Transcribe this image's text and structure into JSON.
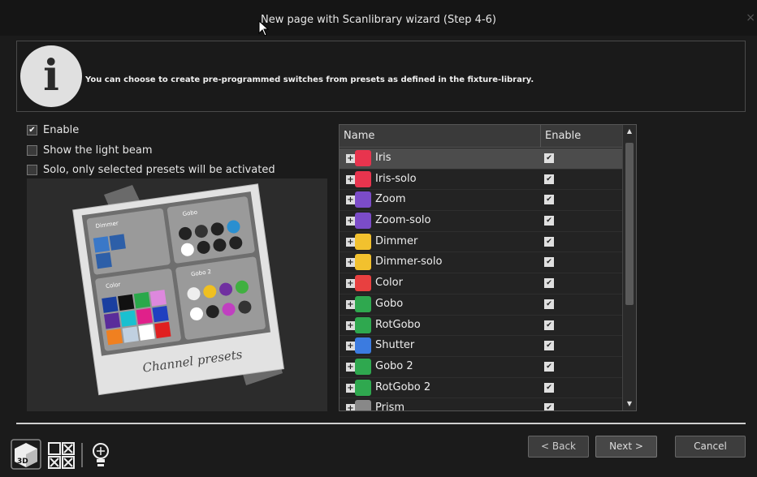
{
  "window": {
    "title": "New page with Scanlibrary wizard (Step 4-6)",
    "close": "×"
  },
  "info": {
    "icon": "i",
    "text": "You can choose to create pre-programmed switches from presets as defined in the fixture-library."
  },
  "options": [
    {
      "label": "Enable",
      "checked": true
    },
    {
      "label": "Show the light beam",
      "checked": false
    },
    {
      "label": "Solo, only selected presets will be activated",
      "checked": false
    }
  ],
  "preview": {
    "caption": "Channel presets",
    "panels": [
      "Dimmer",
      "Gobo",
      "Color",
      "Gobo 2"
    ]
  },
  "table": {
    "headers": {
      "name": "Name",
      "enable": "Enable"
    },
    "rows": [
      {
        "name": "Iris",
        "icon": "iris-icon",
        "color": "#e8344e",
        "checked": true
      },
      {
        "name": "Iris-solo",
        "icon": "iris-icon",
        "color": "#e8344e",
        "checked": true
      },
      {
        "name": "Zoom",
        "icon": "zoom-icon",
        "color": "#7b4cc8",
        "checked": true
      },
      {
        "name": "Zoom-solo",
        "icon": "zoom-icon",
        "color": "#7b4cc8",
        "checked": true
      },
      {
        "name": "Dimmer",
        "icon": "dimmer-icon",
        "color": "#f2c12e",
        "checked": true
      },
      {
        "name": "Dimmer-solo",
        "icon": "dimmer-icon",
        "color": "#f2c12e",
        "checked": true
      },
      {
        "name": "Color",
        "icon": "color-wheel-icon",
        "color": "#e84040",
        "checked": true
      },
      {
        "name": "Gobo",
        "icon": "gobo-icon",
        "color": "#2fa84f",
        "checked": true
      },
      {
        "name": "RotGobo",
        "icon": "rotgobo-icon",
        "color": "#2fa84f",
        "checked": true
      },
      {
        "name": "Shutter",
        "icon": "shutter-icon",
        "color": "#3b7be0",
        "checked": true
      },
      {
        "name": "Gobo 2",
        "icon": "gobo-icon",
        "color": "#2fa84f",
        "checked": true
      },
      {
        "name": "RotGobo 2",
        "icon": "rotgobo-icon",
        "color": "#2fa84f",
        "checked": true
      },
      {
        "name": "Prism",
        "icon": "prism-icon",
        "color": "#888888",
        "checked": true
      }
    ]
  },
  "buttons": {
    "back": "< Back",
    "next": "Next >",
    "cancel": "Cancel"
  },
  "bottom_icons": [
    "3d-view-icon",
    "grid-icon",
    "bulb-icon"
  ],
  "bottom_icon_text": "3D"
}
